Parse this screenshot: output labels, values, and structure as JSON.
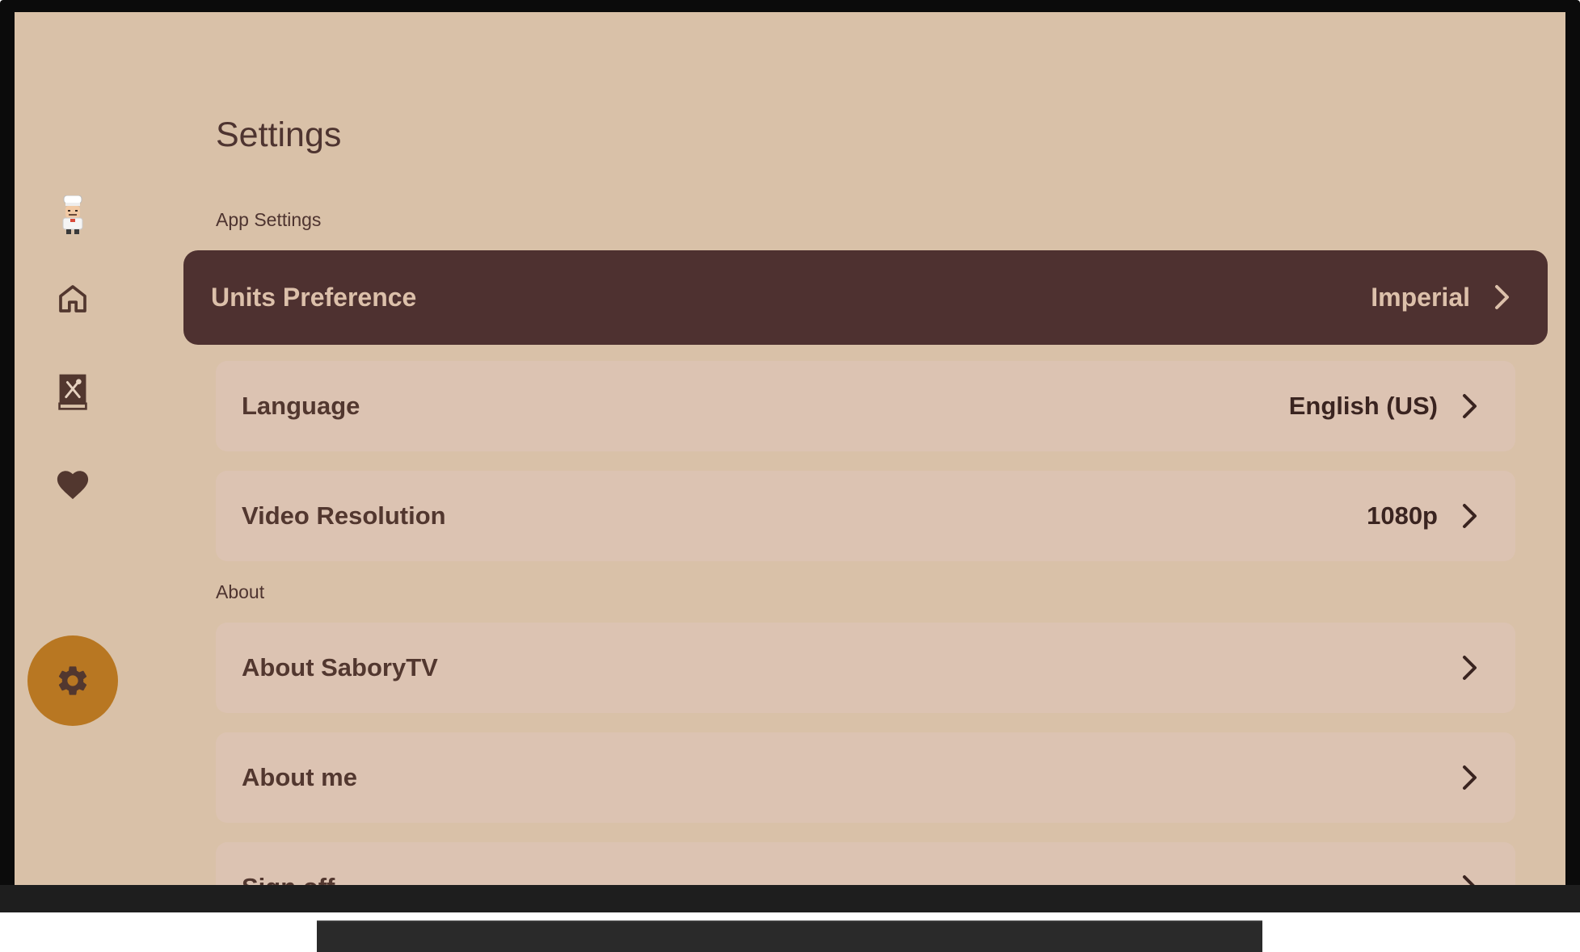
{
  "page": {
    "title": "Settings"
  },
  "nav": {
    "items": [
      {
        "id": "profile",
        "icon": "chef-avatar-icon"
      },
      {
        "id": "home",
        "icon": "home-icon"
      },
      {
        "id": "recipes",
        "icon": "recipe-book-icon"
      },
      {
        "id": "favorites",
        "icon": "heart-icon"
      },
      {
        "id": "settings",
        "icon": "gear-icon",
        "active": true
      }
    ]
  },
  "sections": {
    "app_settings": {
      "label": "App Settings",
      "rows": [
        {
          "label": "Units Preference",
          "value": "Imperial",
          "focused": true
        },
        {
          "label": "Language",
          "value": "English (US)"
        },
        {
          "label": "Video Resolution",
          "value": "1080p"
        }
      ]
    },
    "about": {
      "label": "About",
      "rows": [
        {
          "label": "About SaboryTV",
          "value": ""
        },
        {
          "label": "About me",
          "value": ""
        },
        {
          "label": "Sign off",
          "value": ""
        }
      ]
    }
  },
  "colors": {
    "background": "#d9c1a8",
    "row": "#dcc3b2",
    "focused_row": "#4e3130",
    "active_nav": "#b87722",
    "text": "#52372f"
  }
}
